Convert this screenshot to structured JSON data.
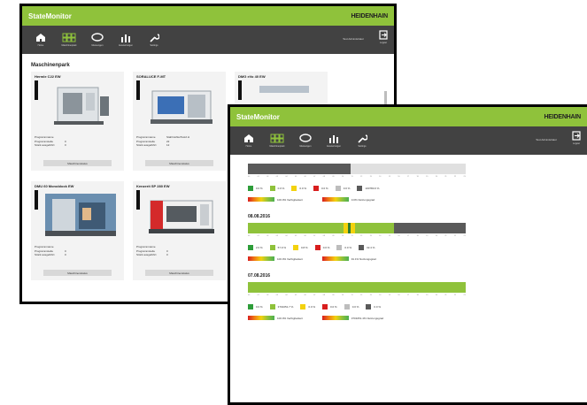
{
  "app": {
    "title": "StateMonitor",
    "brand": "HEIDENHAIN"
  },
  "toolbar": {
    "items": [
      {
        "label": "Home",
        "icon": "home-icon"
      },
      {
        "label": "Maschinenpark",
        "icon": "grid-icon"
      },
      {
        "label": "Messengen",
        "icon": "chat-icon"
      },
      {
        "label": "Auswertungen",
        "icon": "bar-chart-icon"
      },
      {
        "label": "Settings",
        "icon": "wrench-icon"
      }
    ],
    "user": "Test Administrator",
    "logout": "Logout"
  },
  "machinepark": {
    "title": "Maschinenpark",
    "button_label": "Maschinenstatus",
    "cards": [
      {
        "title": "Hermle C22 EW",
        "field1": "Programmname",
        "val1": "",
        "field2": "Programmstelle",
        "val2": "0",
        "field3": "Stück ausgeführt",
        "val3": "0"
      },
      {
        "title": "SORALUCE F-MT",
        "field1": "Programmname",
        "val1": "Stahlmühle/Test2.H",
        "field2": "Programmstelle",
        "val2": "22",
        "field3": "Stück ausgeführt",
        "val3": "12"
      },
      {
        "title": "DMG eVo 40 EW",
        "field1": "",
        "val1": "",
        "field2": "",
        "val2": "",
        "field3": "",
        "val3": ""
      },
      {
        "title": "DMU 60 Monoblock EW",
        "field1": "Programmname",
        "val1": "",
        "field2": "Programmstelle",
        "val2": "0",
        "field3": "Stück ausgeführt",
        "val3": "0"
      },
      {
        "title": "Kenzerit SP 280 EW",
        "field1": "Programmname",
        "val1": "",
        "field2": "Programmstelle",
        "val2": "0",
        "field3": "Stück ausgeführt",
        "val3": "0"
      }
    ]
  },
  "timeline": {
    "sections": [
      {
        "date": "",
        "legend": [
          "0.0 %",
          "0.0 %",
          "0.0 %",
          "0.0 %",
          "0.0 %",
          "100780.0 %"
        ],
        "kpi1": "100.0% Verfügbarkeit",
        "kpi2": "0.0% Nutzungsgrad",
        "bar": [
          {
            "c": "#5a5a5a",
            "w": 0.47
          },
          {
            "c": "#e0e0e0",
            "w": 0.53
          }
        ]
      },
      {
        "date": "08.08.2016",
        "legend": [
          "2.0 %",
          "57.9 %",
          "0.8 %",
          "0.0 %",
          "0.0 %",
          "32.4 %"
        ],
        "kpi1": "100.0% Verfügbarkeit",
        "kpi2": "91.1% Nutzungsgrad",
        "bar": [
          {
            "c": "#8fc23b",
            "w": 0.44
          },
          {
            "c": "#f3d20e",
            "w": 0.02
          },
          {
            "c": "#2e7d32",
            "w": 0.01
          },
          {
            "c": "#f3d20e",
            "w": 0.02
          },
          {
            "c": "#8fc23b",
            "w": 0.18
          },
          {
            "c": "#5a5a5a",
            "w": 0.33
          }
        ]
      },
      {
        "date": "07.08.2016",
        "legend": [
          "0.0 %",
          "3701051.7 %",
          "0.0 %",
          "0.0 %",
          "0.0 %",
          "0.0 %"
        ],
        "kpi1": "100.0% Verfügbarkeit",
        "kpi2": "3701051.4% Nutzungsgrad",
        "bar": [
          {
            "c": "#8fc23b",
            "w": 1.0
          }
        ]
      }
    ],
    "legend_colors": [
      "#2e9d3a",
      "#8fc23b",
      "#f3d20e",
      "#d81e1e",
      "#bdbdbd",
      "#5a5a5a"
    ],
    "ticks": [
      "00",
      "01",
      "02",
      "03",
      "04",
      "05",
      "06",
      "07",
      "08",
      "09",
      "10",
      "11",
      "12",
      "13",
      "14",
      "15",
      "16",
      "17",
      "18",
      "19",
      "20",
      "21",
      "22",
      "23"
    ]
  }
}
